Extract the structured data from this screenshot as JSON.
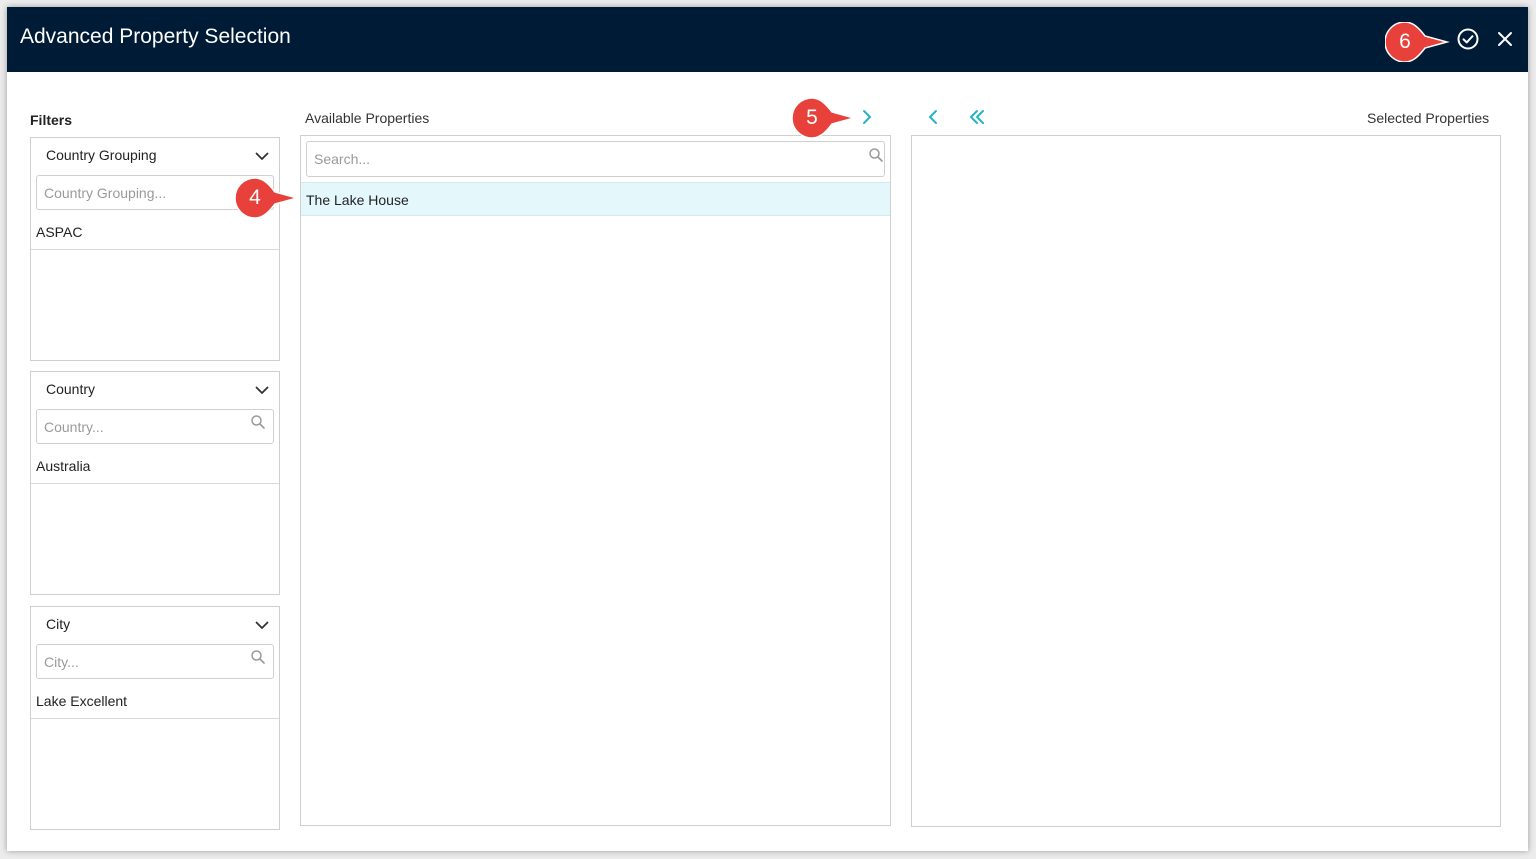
{
  "dialog": {
    "title": "Advanced Property Selection"
  },
  "filters": {
    "label": "Filters",
    "country_grouping": {
      "title": "Country Grouping",
      "placeholder": "Country Grouping...",
      "value": "ASPAC"
    },
    "country": {
      "title": "Country",
      "placeholder": "Country...",
      "value": "Australia"
    },
    "city": {
      "title": "City",
      "placeholder": "City...",
      "value": "Lake Excellent"
    }
  },
  "available": {
    "label": "Available Properties",
    "search_placeholder": "Search...",
    "items": [
      "The Lake House"
    ]
  },
  "selected": {
    "label": "Selected Properties"
  },
  "callouts": [
    "4",
    "5",
    "6"
  ],
  "colors": {
    "titlebar": "#001b36",
    "accent": "#26b3c4",
    "callout": "#e8413c",
    "highlight_row": "#e4f8fc"
  },
  "icons": {
    "confirm": "check-circle-icon",
    "close": "close-icon",
    "move_right": "chevron-right-icon",
    "move_left": "chevron-left-icon",
    "move_all_left": "double-chevron-left-icon",
    "search": "search-icon",
    "expand": "chevron-down-icon"
  }
}
